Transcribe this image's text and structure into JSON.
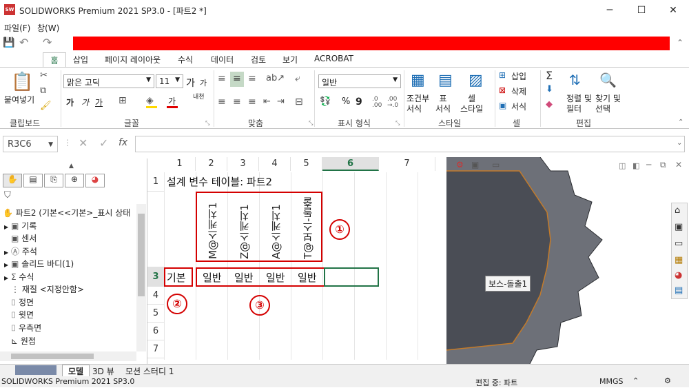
{
  "window": {
    "title": "SOLIDWORKS Premium 2021 SP3.0 - [파트2 *]",
    "minimize": "─",
    "maximize": "☐",
    "close": "✕"
  },
  "menu": {
    "file": "파일(F)",
    "window": "창(W)"
  },
  "ribbon_tabs": [
    "홈",
    "삽입",
    "페이지 레이아웃",
    "수식",
    "데이터",
    "검토",
    "보기",
    "ACROBAT"
  ],
  "ribbon": {
    "clipboard": {
      "paste": "붙여넣기",
      "label": "클립보드"
    },
    "font": {
      "name": "맑은 고딕",
      "size": "11",
      "grow": "가",
      "shrink": "가",
      "bold": "가",
      "italic": "가",
      "underline": "가",
      "phonetic": "내천",
      "label": "글꼴"
    },
    "align": {
      "label": "맞춤"
    },
    "number": {
      "format": "일반",
      "label": "표시 형식"
    },
    "style": {
      "conditional": "조건부\n서식",
      "table": "표\n서식",
      "cell": "셀\n스타일",
      "label": "스타일"
    },
    "cells": {
      "insert": "삽입",
      "delete": "삭제",
      "format": "서식",
      "label": "셀"
    },
    "edit": {
      "sort": "정렬 및\n필터",
      "find": "찾기 및\n선택",
      "label": "편집"
    }
  },
  "formula": {
    "namebox": "R3C6",
    "fx": "fx"
  },
  "feature_tree": {
    "root": "파트2  (기본<<기본>_표시 상태",
    "items": [
      "기록",
      "센서",
      "주석",
      "솔리드 바디(1)",
      "수식",
      "재질 <지정안함>",
      "정면",
      "윗면",
      "우측면",
      "원점"
    ]
  },
  "sheet": {
    "columns": [
      "1",
      "2",
      "3",
      "4",
      "5",
      "6",
      "7"
    ],
    "rows": [
      "1",
      "",
      "3",
      "4",
      "5",
      "6",
      "7"
    ],
    "title": "설계 변수 테이블: 파트2",
    "headers": [
      "M@스케치1",
      "Z@스케치1",
      "A@스케치1",
      "T@보스-돌출"
    ],
    "row_label": "기본",
    "values": [
      "일반",
      "일반",
      "일반",
      "일반"
    ],
    "callouts": [
      "①",
      "②",
      "③"
    ]
  },
  "viewport": {
    "tooltip": "보스-돌출1"
  },
  "sheet_tabs": [
    "모델",
    "3D 뷰",
    "모션 스터디 1"
  ],
  "status": {
    "app": "SOLIDWORKS Premium 2021 SP3.0",
    "editing": "편집 중: 파트",
    "units": "MMGS"
  },
  "colors": {
    "accent": "#217346",
    "red": "#ff0000",
    "callout": "#d40000"
  }
}
